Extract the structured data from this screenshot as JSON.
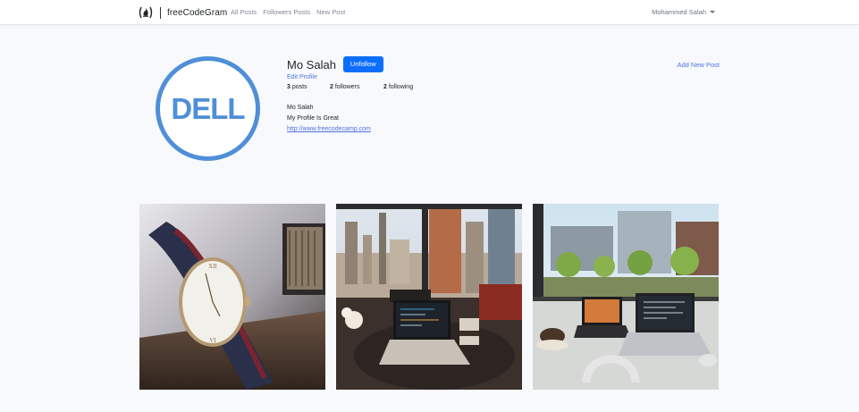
{
  "navbar": {
    "brand": "freeCodeGram",
    "links": [
      "All Posts",
      "Followers Posts",
      "New Post"
    ],
    "user": "Mohammed Salah"
  },
  "profile": {
    "avatar_logo_text": "DELL",
    "name": "Mo Salah",
    "follow_button": "Unfollow",
    "add_post": "Add New Post",
    "edit_profile": "Edit Profile",
    "stats": {
      "posts_count": "3",
      "posts_label": "posts",
      "followers_count": "2",
      "followers_label": "followers",
      "following_count": "2",
      "following_label": "following"
    },
    "bio": {
      "title": "Mo Salah",
      "description": "My Profile Is Great",
      "url": "http://www.freecodecamp.com"
    }
  },
  "colors": {
    "primary": "#0d6efd",
    "link": "#4e73df",
    "dell_blue": "#4f8fd8",
    "background": "#f8f9fc"
  },
  "icons": [
    "freecodecamp-logo-icon",
    "caret-down-icon"
  ],
  "posts": [
    {
      "image": "wristwatch-photo"
    },
    {
      "image": "laptop-city-window-photo"
    },
    {
      "image": "laptops-canal-view-photo"
    }
  ]
}
